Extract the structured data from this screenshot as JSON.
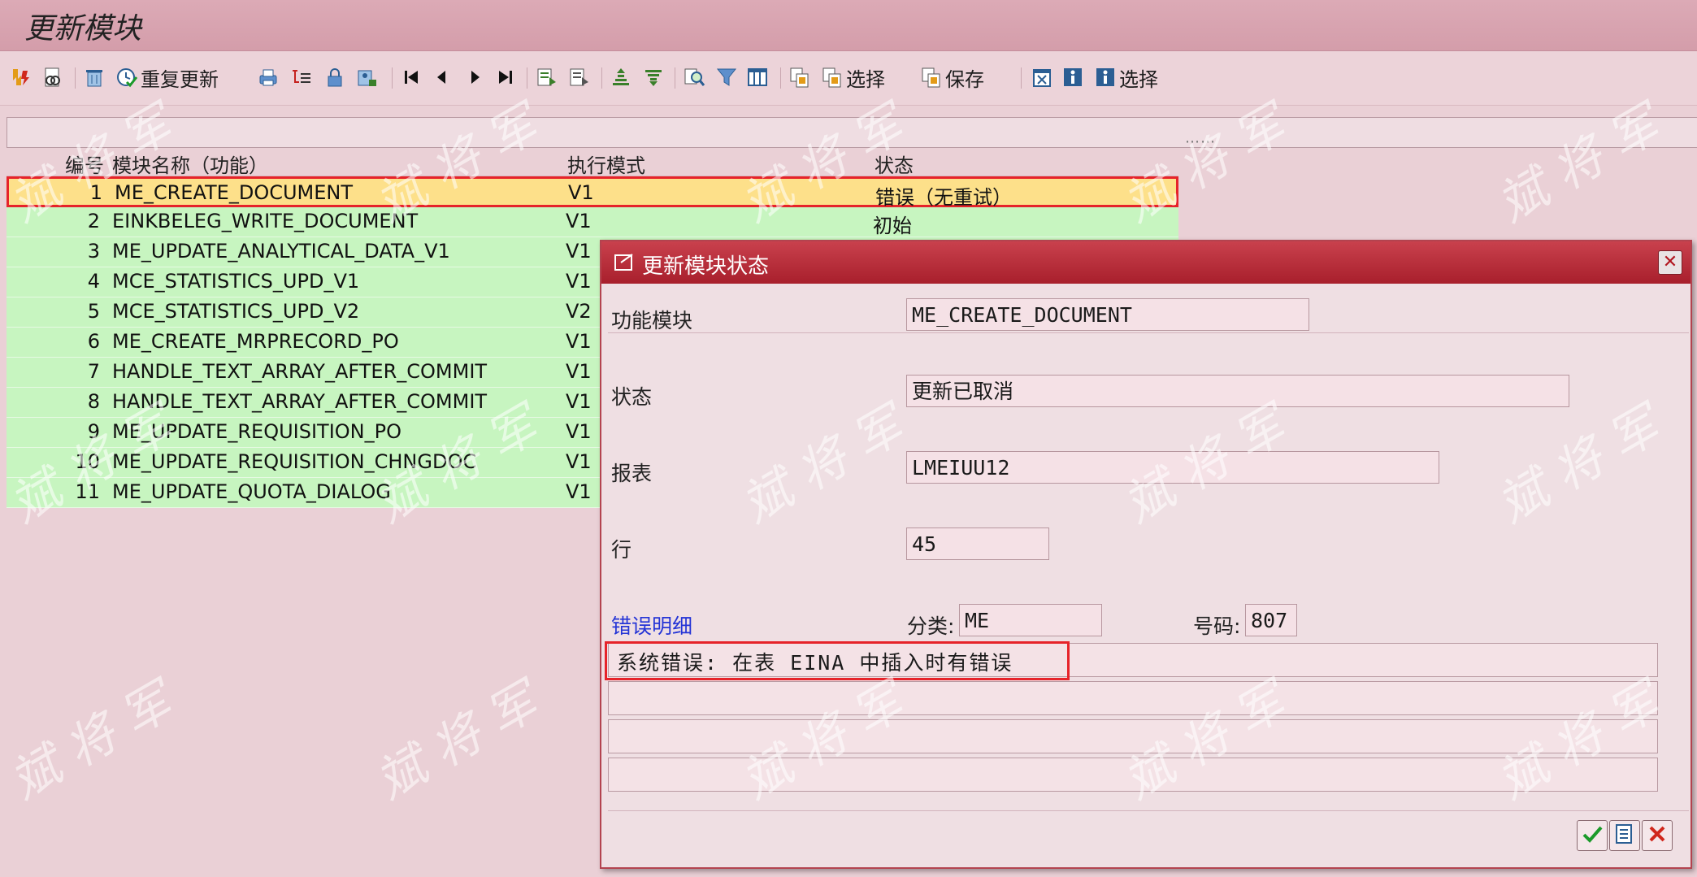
{
  "window": {
    "title": "更新模块"
  },
  "toolbar": {
    "buttons": [
      {
        "icon": "execute-icon"
      },
      {
        "icon": "display-icon"
      },
      {
        "icon": "delete-icon"
      },
      {
        "icon": "repeat-update-icon",
        "label": "重复更新"
      },
      {
        "icon": "print-icon"
      },
      {
        "icon": "hierarchy-icon"
      },
      {
        "icon": "lock-icon"
      },
      {
        "icon": "user-lock-icon"
      },
      {
        "icon": "first-page-icon"
      },
      {
        "icon": "prev-page-icon"
      },
      {
        "icon": "next-page-icon"
      },
      {
        "icon": "last-page-icon"
      },
      {
        "icon": "details-icon"
      },
      {
        "icon": "details2-icon"
      },
      {
        "icon": "sort-asc-icon"
      },
      {
        "icon": "sort-desc-icon"
      },
      {
        "icon": "find-icon"
      },
      {
        "icon": "filter-icon"
      },
      {
        "icon": "layout-icon"
      },
      {
        "icon": "copy-icon"
      },
      {
        "icon": "select-layout-icon",
        "label": "选择"
      },
      {
        "icon": "save-layout-icon",
        "label": "保存"
      },
      {
        "icon": "export-icon"
      },
      {
        "icon": "info-icon"
      },
      {
        "icon": "info-select-icon",
        "label": "选择"
      }
    ]
  },
  "table": {
    "columns": [
      "编号",
      "模块名称（功能）",
      "执行模式",
      "状态"
    ],
    "rows": [
      {
        "num": "1",
        "name": "ME_CREATE_DOCUMENT",
        "mode": "V1",
        "status": "错误（无重试）"
      },
      {
        "num": "2",
        "name": "EINKBELEG_WRITE_DOCUMENT",
        "mode": "V1",
        "status": "初始"
      },
      {
        "num": "3",
        "name": "ME_UPDATE_ANALYTICAL_DATA_V1",
        "mode": "V1",
        "status": ""
      },
      {
        "num": "4",
        "name": "MCE_STATISTICS_UPD_V1",
        "mode": "V1",
        "status": ""
      },
      {
        "num": "5",
        "name": "MCE_STATISTICS_UPD_V2",
        "mode": "V2",
        "status": ""
      },
      {
        "num": "6",
        "name": "ME_CREATE_MRPRECORD_PO",
        "mode": "V1",
        "status": ""
      },
      {
        "num": "7",
        "name": "HANDLE_TEXT_ARRAY_AFTER_COMMIT",
        "mode": "V1",
        "status": ""
      },
      {
        "num": "8",
        "name": "HANDLE_TEXT_ARRAY_AFTER_COMMIT",
        "mode": "V1",
        "status": ""
      },
      {
        "num": "9",
        "name": "ME_UPDATE_REQUISITION_PO",
        "mode": "V1",
        "status": ""
      },
      {
        "num": "10",
        "name": "ME_UPDATE_REQUISITION_CHNGDOC",
        "mode": "V1",
        "status": ""
      },
      {
        "num": "11",
        "name": "ME_UPDATE_QUOTA_DIALOG",
        "mode": "V1",
        "status": ""
      }
    ]
  },
  "dialog": {
    "title": "更新模块状态",
    "function_module_label": "功能模块",
    "function_module_value": "ME_CREATE_DOCUMENT",
    "status_label": "状态",
    "status_value": "更新已取消",
    "report_label": "报表",
    "report_value": "LMEIUU12",
    "line_label": "行",
    "line_value": "45",
    "error_detail_label": "错误明细",
    "class_label": "分类:",
    "class_value": "ME",
    "number_label": "号码:",
    "number_value": "807",
    "messages": [
      "系统错误: 在表 EINA 中插入时有错误",
      "",
      "",
      ""
    ]
  },
  "watermark": "斌将军",
  "colors": {
    "selected_row": "#fde08a",
    "row": "#c7f5c0",
    "highlight": "#e6232a",
    "dialog_title": "#b8303c"
  }
}
